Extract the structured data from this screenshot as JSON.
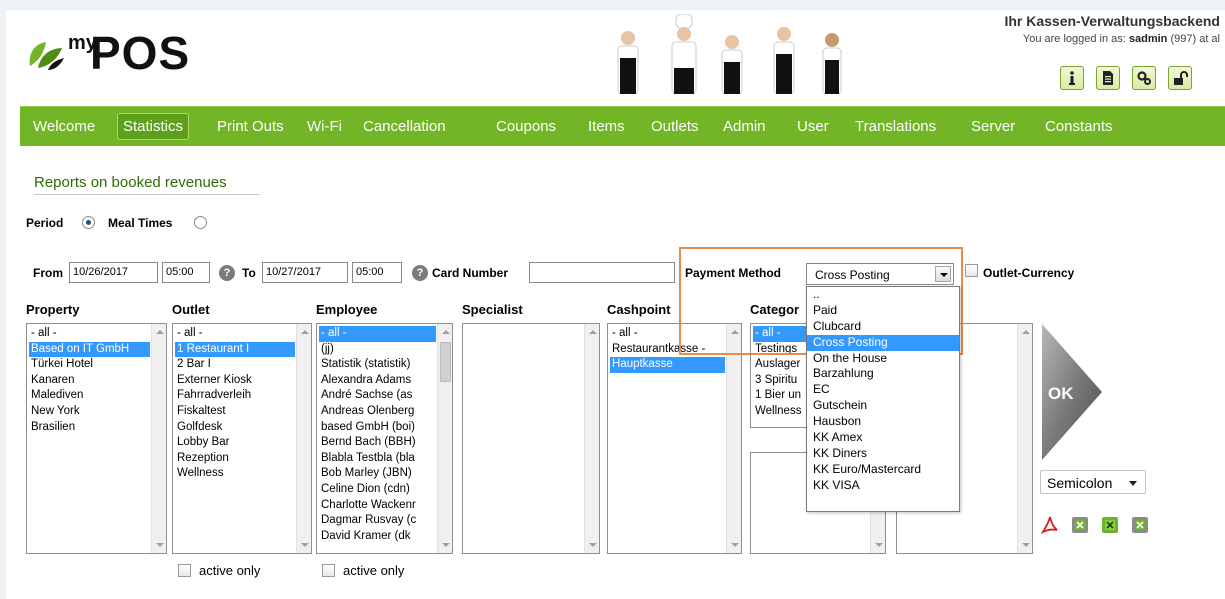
{
  "header": {
    "logo_my": "my",
    "logo_pos": "POS",
    "title": "Ihr Kassen-Verwaltungsbackend",
    "login_prefix": "You are logged in as: ",
    "login_user": "sadmin",
    "login_suffix": " (997) at al",
    "icons": [
      "info-icon",
      "document-icon",
      "settings-icon",
      "unlock-icon"
    ]
  },
  "nav": {
    "items": [
      "Welcome",
      "Statistics",
      "Print Outs",
      "Wi-Fi",
      "Cancellation",
      "Coupons",
      "Items",
      "Outlets",
      "Admin",
      "User",
      "Translations",
      "Server",
      "Constants"
    ],
    "active": "Statistics"
  },
  "report": {
    "title": "Reports on booked revenues",
    "period_label": "Period",
    "mealtimes_label": "Meal Times",
    "period_selected": "Period"
  },
  "filters": {
    "from_label": "From",
    "from_date": "10/26/2017",
    "from_time": "05:00",
    "to_label": "To",
    "to_date": "10/27/2017",
    "to_time": "05:00",
    "card_number_label": "Card Number",
    "card_number_value": "",
    "payment_method_label": "Payment Method",
    "payment_method_value": "Cross Posting",
    "outlet_currency_label": "Outlet-Currency"
  },
  "columns": {
    "property": {
      "header": "Property",
      "options": [
        "- all -",
        "Based on IT GmbH",
        "Türkei Hotel",
        "Kanaren",
        "Malediven",
        "New York",
        "Brasilien"
      ],
      "selected": "Based on IT GmbH"
    },
    "outlet": {
      "header": "Outlet",
      "options": [
        "- all -",
        "1 Restaurant I",
        "2 Bar I",
        "Externer Kiosk",
        "Fahrradverleih",
        "Fiskaltest",
        "Golfdesk",
        "Lobby Bar",
        "Rezeption",
        "Wellness"
      ],
      "selected": "1 Restaurant I"
    },
    "employee": {
      "header": "Employee",
      "options": [
        "- all -",
        "(jj)",
        "Statistik (statistik)",
        "Alexandra Adams",
        "André Sachse (as",
        "Andreas Olenberg",
        "based GmbH (boi)",
        "Bernd Bach (BBH)",
        "Blabla Testbla (bla",
        "Bob Marley (JBN)",
        "Celine Dion (cdn)",
        "Charlotte Wackenr",
        "Dagmar Rusvay (c",
        "David Kramer (dk"
      ],
      "selected": "- all -"
    },
    "specialist": {
      "header": "Specialist",
      "options": []
    },
    "cashpoint": {
      "header": "Cashpoint",
      "options": [
        "- all -",
        "Restaurantkasse -",
        "Hauptkasse"
      ],
      "selected": "Hauptkasse"
    },
    "category": {
      "header": "Categor",
      "options": [
        "- all -",
        "Testings",
        "Auslager",
        "3 Spiritu",
        "1 Bier un",
        "Wellness"
      ],
      "selected": "- all -"
    },
    "active_only_label": "active only"
  },
  "payment_dropdown": {
    "options": [
      "..",
      "Paid",
      "Clubcard",
      "Cross Posting",
      "On the House",
      "Barzahlung",
      "EC",
      "Gutschein",
      "Hausbon",
      "KK Amex",
      "KK Diners",
      "KK Euro/Mastercard",
      "KK VISA"
    ],
    "selected": "Cross Posting"
  },
  "actions": {
    "ok_label": "OK",
    "separator_value": "Semicolon",
    "export_icons": [
      "pdf-icon",
      "excel-icon",
      "excel-icon",
      "excel-icon"
    ]
  },
  "colors": {
    "nav_green": "#72b527",
    "title_green": "#2f6b06",
    "highlight_orange": "#e98a49",
    "selection_blue": "#3399ff"
  }
}
